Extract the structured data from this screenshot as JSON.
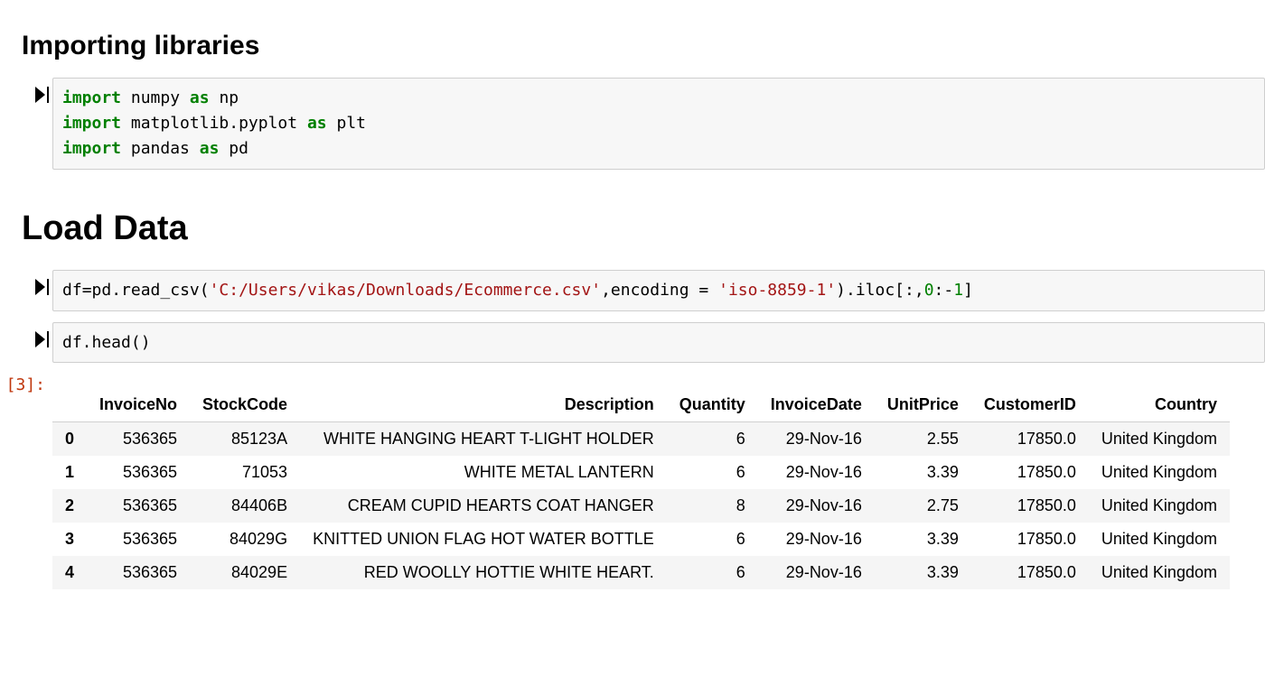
{
  "headings": {
    "importing": "Importing libraries",
    "load_data": "Load Data"
  },
  "code_cell_1": {
    "tokens": [
      {
        "t": "kw",
        "v": "import"
      },
      {
        "t": "sp",
        "v": " "
      },
      {
        "t": "txt",
        "v": "numpy"
      },
      {
        "t": "sp",
        "v": " "
      },
      {
        "t": "kw",
        "v": "as"
      },
      {
        "t": "sp",
        "v": " "
      },
      {
        "t": "txt",
        "v": "np"
      },
      {
        "t": "nl"
      },
      {
        "t": "kw",
        "v": "import"
      },
      {
        "t": "sp",
        "v": " "
      },
      {
        "t": "txt",
        "v": "matplotlib.pyplot"
      },
      {
        "t": "sp",
        "v": " "
      },
      {
        "t": "kw",
        "v": "as"
      },
      {
        "t": "sp",
        "v": " "
      },
      {
        "t": "txt",
        "v": "plt"
      },
      {
        "t": "nl"
      },
      {
        "t": "kw",
        "v": "import"
      },
      {
        "t": "sp",
        "v": " "
      },
      {
        "t": "txt",
        "v": "pandas"
      },
      {
        "t": "sp",
        "v": " "
      },
      {
        "t": "kw",
        "v": "as"
      },
      {
        "t": "sp",
        "v": " "
      },
      {
        "t": "txt",
        "v": "pd"
      }
    ]
  },
  "code_cell_2": {
    "tokens": [
      {
        "t": "txt",
        "v": "df"
      },
      {
        "t": "op",
        "v": "="
      },
      {
        "t": "txt",
        "v": "pd.read_csv("
      },
      {
        "t": "str",
        "v": "'C:/Users/vikas/Downloads/Ecommerce.csv'"
      },
      {
        "t": "txt",
        "v": ",encoding = "
      },
      {
        "t": "str",
        "v": "'iso-8859-1'"
      },
      {
        "t": "txt",
        "v": ").iloc[:,"
      },
      {
        "t": "num",
        "v": "0"
      },
      {
        "t": "txt",
        "v": ":"
      },
      {
        "t": "op",
        "v": "-"
      },
      {
        "t": "num",
        "v": "1"
      },
      {
        "t": "txt",
        "v": "]"
      }
    ]
  },
  "code_cell_3": {
    "tokens": [
      {
        "t": "txt",
        "v": "df.head()"
      }
    ]
  },
  "output_label": "[3]:",
  "table": {
    "columns": [
      "InvoiceNo",
      "StockCode",
      "Description",
      "Quantity",
      "InvoiceDate",
      "UnitPrice",
      "CustomerID",
      "Country"
    ],
    "rows": [
      {
        "idx": "0",
        "InvoiceNo": "536365",
        "StockCode": "85123A",
        "Description": "WHITE HANGING HEART T-LIGHT HOLDER",
        "Quantity": "6",
        "InvoiceDate": "29-Nov-16",
        "UnitPrice": "2.55",
        "CustomerID": "17850.0",
        "Country": "United Kingdom"
      },
      {
        "idx": "1",
        "InvoiceNo": "536365",
        "StockCode": "71053",
        "Description": "WHITE METAL LANTERN",
        "Quantity": "6",
        "InvoiceDate": "29-Nov-16",
        "UnitPrice": "3.39",
        "CustomerID": "17850.0",
        "Country": "United Kingdom"
      },
      {
        "idx": "2",
        "InvoiceNo": "536365",
        "StockCode": "84406B",
        "Description": "CREAM CUPID HEARTS COAT HANGER",
        "Quantity": "8",
        "InvoiceDate": "29-Nov-16",
        "UnitPrice": "2.75",
        "CustomerID": "17850.0",
        "Country": "United Kingdom"
      },
      {
        "idx": "3",
        "InvoiceNo": "536365",
        "StockCode": "84029G",
        "Description": "KNITTED UNION FLAG HOT WATER BOTTLE",
        "Quantity": "6",
        "InvoiceDate": "29-Nov-16",
        "UnitPrice": "3.39",
        "CustomerID": "17850.0",
        "Country": "United Kingdom"
      },
      {
        "idx": "4",
        "InvoiceNo": "536365",
        "StockCode": "84029E",
        "Description": "RED WOOLLY HOTTIE WHITE HEART.",
        "Quantity": "6",
        "InvoiceDate": "29-Nov-16",
        "UnitPrice": "3.39",
        "CustomerID": "17850.0",
        "Country": "United Kingdom"
      }
    ]
  }
}
